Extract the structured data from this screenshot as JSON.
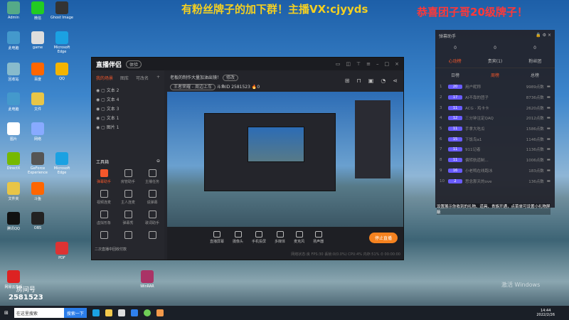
{
  "banners": {
    "left": "有粉丝牌子的加下群！主播VX:cjyyds",
    "right": "恭喜团子哥20级牌子！"
  },
  "desktop_icons": [
    "Admin",
    "微信",
    "Ghost Image",
    "此电脑",
    "game",
    "Microsoft Edge",
    "回收站",
    "百度",
    "QQ",
    "此电脑",
    "文件",
    "图片",
    "网络",
    "DirectX",
    "GeForce Experience",
    "Microsoft Edge",
    "文件夹",
    "斗鱼",
    "腾讯QQ",
    "OBS",
    "PDF",
    "网易云音乐",
    "WinRAR"
  ],
  "room_watermark": {
    "label": "房间号",
    "number": "2581523"
  },
  "app": {
    "title": "直播伴侣",
    "version_pill": "体验",
    "tabs": [
      "我的场景",
      "图库",
      "可改名"
    ],
    "sources": [
      "文本 2",
      "文本 4",
      "文本 3",
      "文本 1",
      "图片 1"
    ],
    "toolbox_title": "工具箱",
    "tools": [
      "弹幕助手",
      "房管助手",
      "主播任务",
      "视频连麦",
      "主人连麦",
      "说弹幕",
      "虚拟形象",
      "弹幕秀",
      "歌词助手",
      "",
      "",
      " "
    ],
    "tip": "二次直播中回收付款",
    "stream_title": "老板的制作大量加油出镜！",
    "edit_label": "修改",
    "category": "王者荣耀 - 周边上车",
    "room_id_label": "斗鱼ID",
    "room_id": "2581523",
    "hot": "0",
    "bottom_buttons": [
      "直播屏幕",
      "摄像头",
      "手机投屏",
      "多媒体",
      "麦克风",
      "扬声器"
    ],
    "stop_label": "停止直播",
    "stats": "网络状态:良 FPS:30 丢帧:0(0.0%) CPU:4% 内存:51%",
    "timer": "00:00:00"
  },
  "panel": {
    "title": "弹幕助手",
    "counts": [
      "0",
      "0",
      "0"
    ],
    "tabs": [
      "心动榜",
      "贵宾(1)",
      "粉丝团"
    ],
    "subtabs": [
      "日榜",
      "周榜",
      "总榜"
    ],
    "ranks": [
      {
        "n": "1",
        "lv": "20",
        "name": "用户昵称",
        "pts": "9989点数"
      },
      {
        "n": "2",
        "lv": "17",
        "name": "AI不靠的团子",
        "pts": "8736点数"
      },
      {
        "n": "3",
        "lv": "11",
        "name": "ACG · 鸡卡卡",
        "pts": "2620点数"
      },
      {
        "n": "4",
        "lv": "12",
        "name": "三分钟注定QAQ",
        "pts": "2012点数"
      },
      {
        "n": "5",
        "lv": "11",
        "name": "手拿大吃瓜",
        "pts": "1586点数"
      },
      {
        "n": "6",
        "lv": "15",
        "name": "下饭鸟a1",
        "pts": "1146点数"
      },
      {
        "n": "7",
        "lv": "11",
        "name": "911记者",
        "pts": "1136点数"
      },
      {
        "n": "8",
        "lv": "11",
        "name": "偏转航道制...",
        "pts": "1006点数"
      },
      {
        "n": "9",
        "lv": "16",
        "name": "小老鸭在线跑冰",
        "pts": "183点数"
      },
      {
        "n": "10",
        "lv": "2",
        "name": "思念那天的ove",
        "pts": "136点数"
      }
    ],
    "note": "设置展示你收到的礼物、道具、贵族开通，点菜单可设置小礼物屏蔽"
  },
  "activation": "激活 Windows",
  "taskbar": {
    "search": "在这里搜索",
    "search_btn": "搜索一下",
    "time": "14:44",
    "date": "2022/2/26"
  }
}
